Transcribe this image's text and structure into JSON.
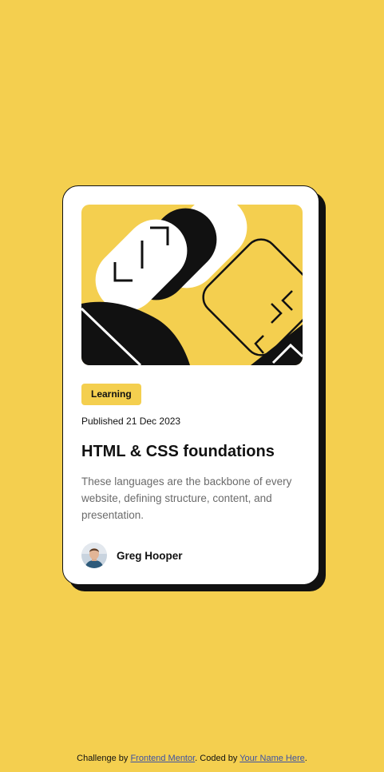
{
  "colors": {
    "background": "#F4CF4F",
    "card": "#FFFFFF",
    "ink": "#111111",
    "muted_text": "#6B6B6B",
    "link": "#3E52A3"
  },
  "card": {
    "image_alt": "illustration-article",
    "tag": "Learning",
    "published": "Published 21 Dec 2023",
    "title": "HTML & CSS foundations",
    "description": "These languages are the backbone of every website, defining structure, content, and presentation.",
    "author": {
      "name": "Greg Hooper",
      "avatar_icon": "avatar-photo"
    }
  },
  "attribution": {
    "prefix": "Challenge by ",
    "challenge_link": "Frontend Mentor",
    "middle": ". Coded by ",
    "coder_link": "Your Name Here",
    "suffix": "."
  }
}
